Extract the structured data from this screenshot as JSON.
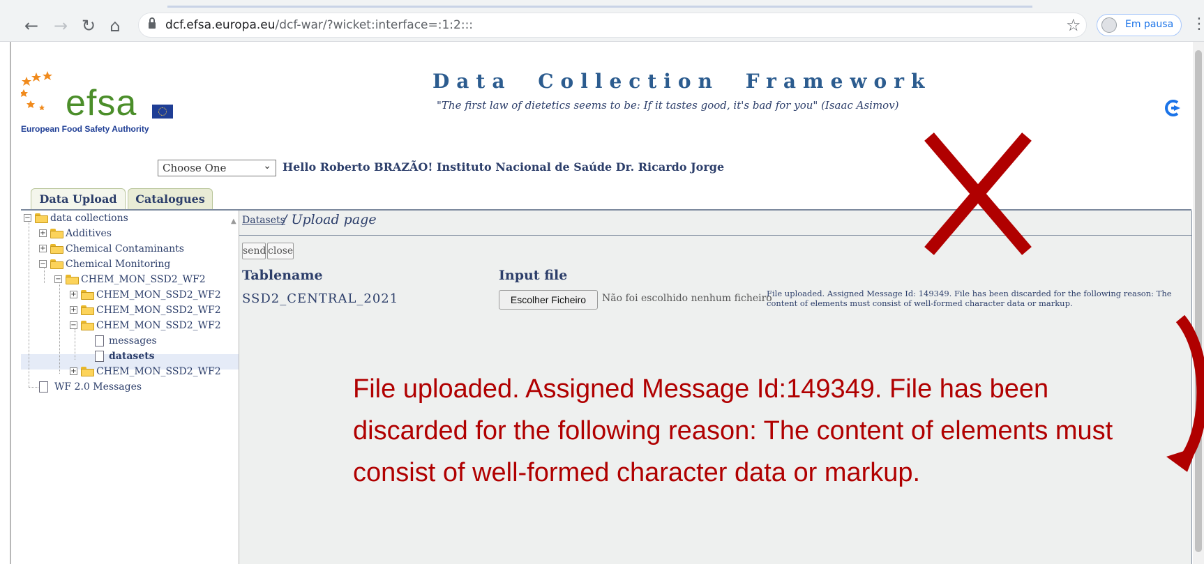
{
  "browser": {
    "url_host": "dcf.efsa.europa.eu",
    "url_path": "/dcf-war/?wicket:interface=:1:2:::",
    "profile_label": "Em pausa"
  },
  "header": {
    "logo_word": "efsa",
    "logo_sub": "European Food Safety Authority",
    "title": "Data Collection Framework",
    "quote": "\"The first law of dietetics seems to be: If it tastes good, it's bad for you\" (Isaac Asimov)"
  },
  "user_bar": {
    "choose_value": "Choose One",
    "greeting": "Hello Roberto BRAZÃO! Instituto Nacional de Saúde Dr. Ricardo Jorge"
  },
  "tabs": [
    {
      "label": "Data Upload",
      "active": true
    },
    {
      "label": "Catalogues",
      "active": false
    }
  ],
  "tree": {
    "items": [
      {
        "label": "data collections"
      },
      {
        "label": "Additives"
      },
      {
        "label": "Chemical Contaminants"
      },
      {
        "label": "Chemical Monitoring"
      },
      {
        "label": "CHEM_MON_SSD2_WF2"
      },
      {
        "label": "CHEM_MON_SSD2_WF2"
      },
      {
        "label": "CHEM_MON_SSD2_WF2"
      },
      {
        "label": "CHEM_MON_SSD2_WF2"
      },
      {
        "label": "messages"
      },
      {
        "label": "datasets"
      },
      {
        "label": "CHEM_MON_SSD2_WF2"
      },
      {
        "label": "WF 2.0 Messages"
      }
    ]
  },
  "main": {
    "crumb_link": "Datasets",
    "crumb_current": "/ Upload page",
    "send_label": "send",
    "close_label": "close",
    "col_tablename": "Tablename",
    "col_input": "Input file",
    "table_value": "SSD2_CENTRAL_2021",
    "file_button": "Escolher Ficheiro",
    "file_status": "Não foi escolhido nenhum ficheiro",
    "message": "File uploaded. Assigned Message Id: 149349. File has been discarded for the following reason: The content of elements must consist of well-formed character data or markup."
  },
  "annotation": {
    "big_message": "File uploaded. Assigned Message Id:149349. File has been discarded for the following reason: The content of elements must consist of well-formed character data or markup.",
    "color": "#b00000"
  }
}
